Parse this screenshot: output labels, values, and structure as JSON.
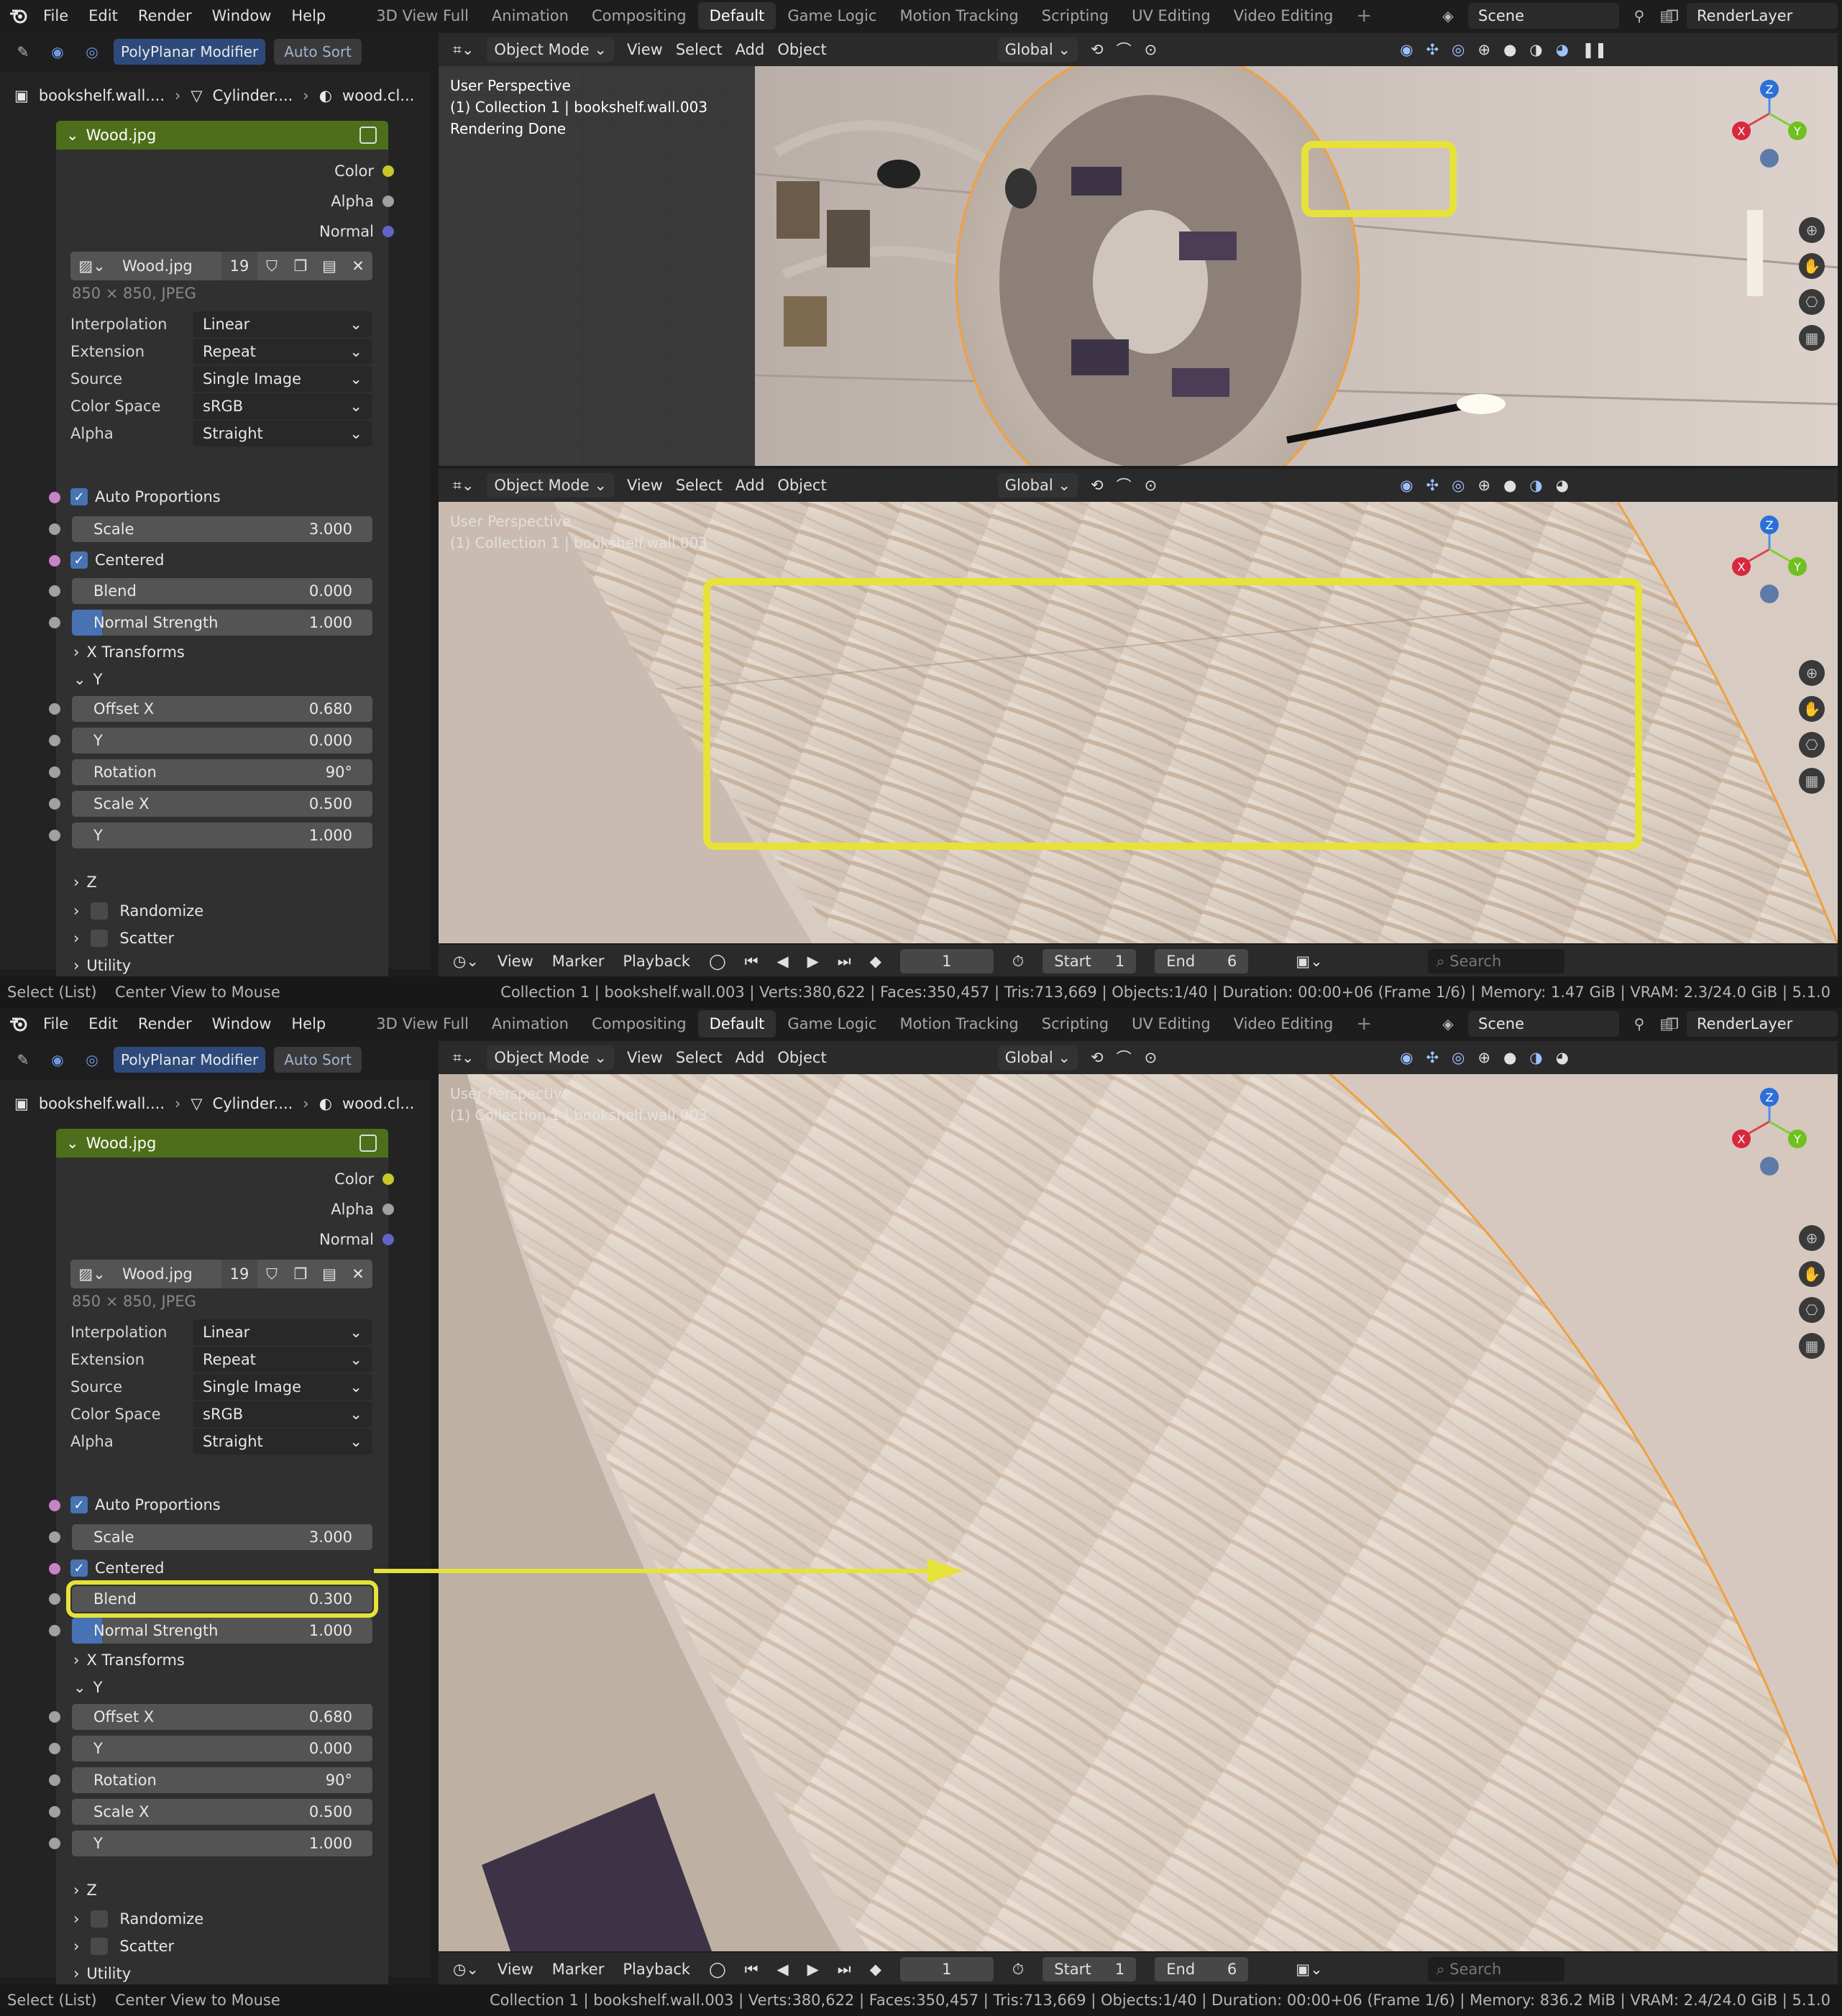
{
  "menu": [
    "File",
    "Edit",
    "Render",
    "Window",
    "Help"
  ],
  "workspaces": [
    "3D View Full",
    "Animation",
    "Compositing",
    "Default",
    "Game Logic",
    "Motion Tracking",
    "Scripting",
    "UV Editing",
    "Video Editing"
  ],
  "active_workspace": "Default",
  "scene": "Scene",
  "render_layer": "RenderLayer",
  "addon": {
    "name": "PolyPlanar Modifier",
    "sort": "Auto Sort"
  },
  "breadcrumb": [
    "bookshelf.wall....",
    "Cylinder....",
    "wood.cl..."
  ],
  "node": {
    "title": "Wood.jpg",
    "sockets": [
      "Color",
      "Alpha",
      "Normal"
    ],
    "image_name": "Wood.jpg",
    "users": "19",
    "image_info": "850 × 850, JPEG",
    "props": [
      {
        "label": "Interpolation",
        "value": "Linear"
      },
      {
        "label": "Extension",
        "value": "Repeat"
      },
      {
        "label": "Source",
        "value": "Single Image"
      },
      {
        "label": "Color Space",
        "value": "sRGB"
      },
      {
        "label": "Alpha",
        "value": "Straight"
      }
    ],
    "auto_proportions": "Auto Proportions",
    "scale_label": "Scale",
    "scale_value": "3.000",
    "centered": "Centered",
    "blend_label": "Blend",
    "normal_strength_label": "Normal Strength",
    "normal_strength_value": "1.000",
    "x_transforms": "X Transforms",
    "y_label": "Y",
    "offset_x_label": "Offset X",
    "offset_x_value": "0.680",
    "y_value": "0.000",
    "rotation_label": "Rotation",
    "rotation_value": "90°",
    "scale_x_label": "Scale X",
    "scale_x_value": "0.500",
    "y2_value": "1.000",
    "z_label": "Z",
    "randomize": "Randomize",
    "scatter": "Scatter",
    "utility": "Utility",
    "normal_strength_fill": 0.1
  },
  "blend_values": {
    "top": "0.000",
    "bottom": "0.300"
  },
  "viewport": {
    "mode": "Object Mode",
    "menus": [
      "View",
      "Select",
      "Add",
      "Object"
    ],
    "orientation": "Global",
    "overlay_line1": "User Perspective",
    "overlay_line2": "(1) Collection 1 | bookshelf.wall.003",
    "overlay_line3": "Rendering Done"
  },
  "timeline": {
    "menus": [
      "View",
      "Marker",
      "Playback"
    ],
    "frame": "1",
    "start_label": "Start",
    "start": "1",
    "end_label": "End",
    "end": "6",
    "search": "Search"
  },
  "status_bar": {
    "select": "Select (List)",
    "center": "Center View to Mouse",
    "info_top": "Collection 1 | bookshelf.wall.003 | Verts:380,622 | Faces:350,457 | Tris:713,669 | Objects:1/40 | Duration: 00:00+06 (Frame 1/6) | Memory: 1.47 GiB | VRAM: 2.3/24.0 GiB | 5.1.0",
    "info_bottom": "Collection 1 | bookshelf.wall.003 | Verts:380,622 | Faces:350,457 | Tris:713,669 | Objects:1/40 | Duration: 00:00+06 (Frame 1/6) | Memory: 836.2 MiB | VRAM: 2.4/24.0 GiB | 5.1.0"
  },
  "gizmo": {
    "x": "X",
    "y": "Y",
    "z": "Z"
  },
  "colors": {
    "highlight": "#e6e23a",
    "accent": "#4772b3",
    "node_header": "#4d6e1a",
    "socket_color": "#c7c729",
    "socket_alpha": "#a1a1a1",
    "socket_normal": "#6363c7"
  }
}
